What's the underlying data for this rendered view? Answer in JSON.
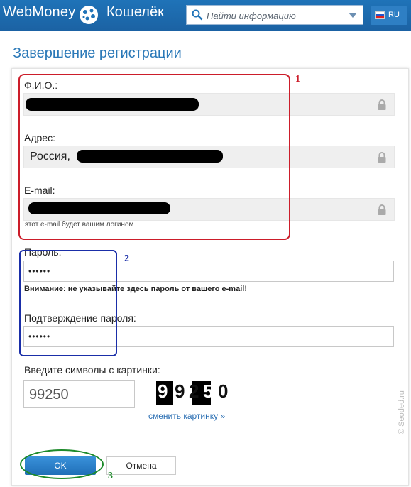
{
  "header": {
    "brand": "WebMoney",
    "product": "Кошелёк",
    "search_placeholder": "Найти информацию",
    "language": "RU",
    "logo_icon": "webmoney-globe-icon",
    "colors": {
      "bar": "#1f73b8",
      "accent": "#2b79b8"
    }
  },
  "page": {
    "title": "Завершение регистрации"
  },
  "form": {
    "fio_label": "Ф.И.О.:",
    "address_label": "Адрес:",
    "address_value": "Россия,",
    "email_label": "E-mail:",
    "email_hint": "этот e-mail будет вашим логином",
    "password_label": "Пароль:",
    "password_value": "••••••",
    "password_warning": "Внимание: не указывайте здесь пароль от вашего e-mail!",
    "confirm_label": "Подтверждение пароля:",
    "confirm_value": "••••••",
    "captcha_label": "Введите символы с картинки:",
    "captcha_value": "99250",
    "captcha_chars": [
      "9",
      "9",
      "2",
      "5",
      "0"
    ],
    "refresh_link": "сменить картинку »",
    "ok_label": "OK",
    "cancel_label": "Отмена"
  },
  "annotations": {
    "box1": "1",
    "box2": "2",
    "box3": "3"
  },
  "watermark": "© Seoded.ru"
}
